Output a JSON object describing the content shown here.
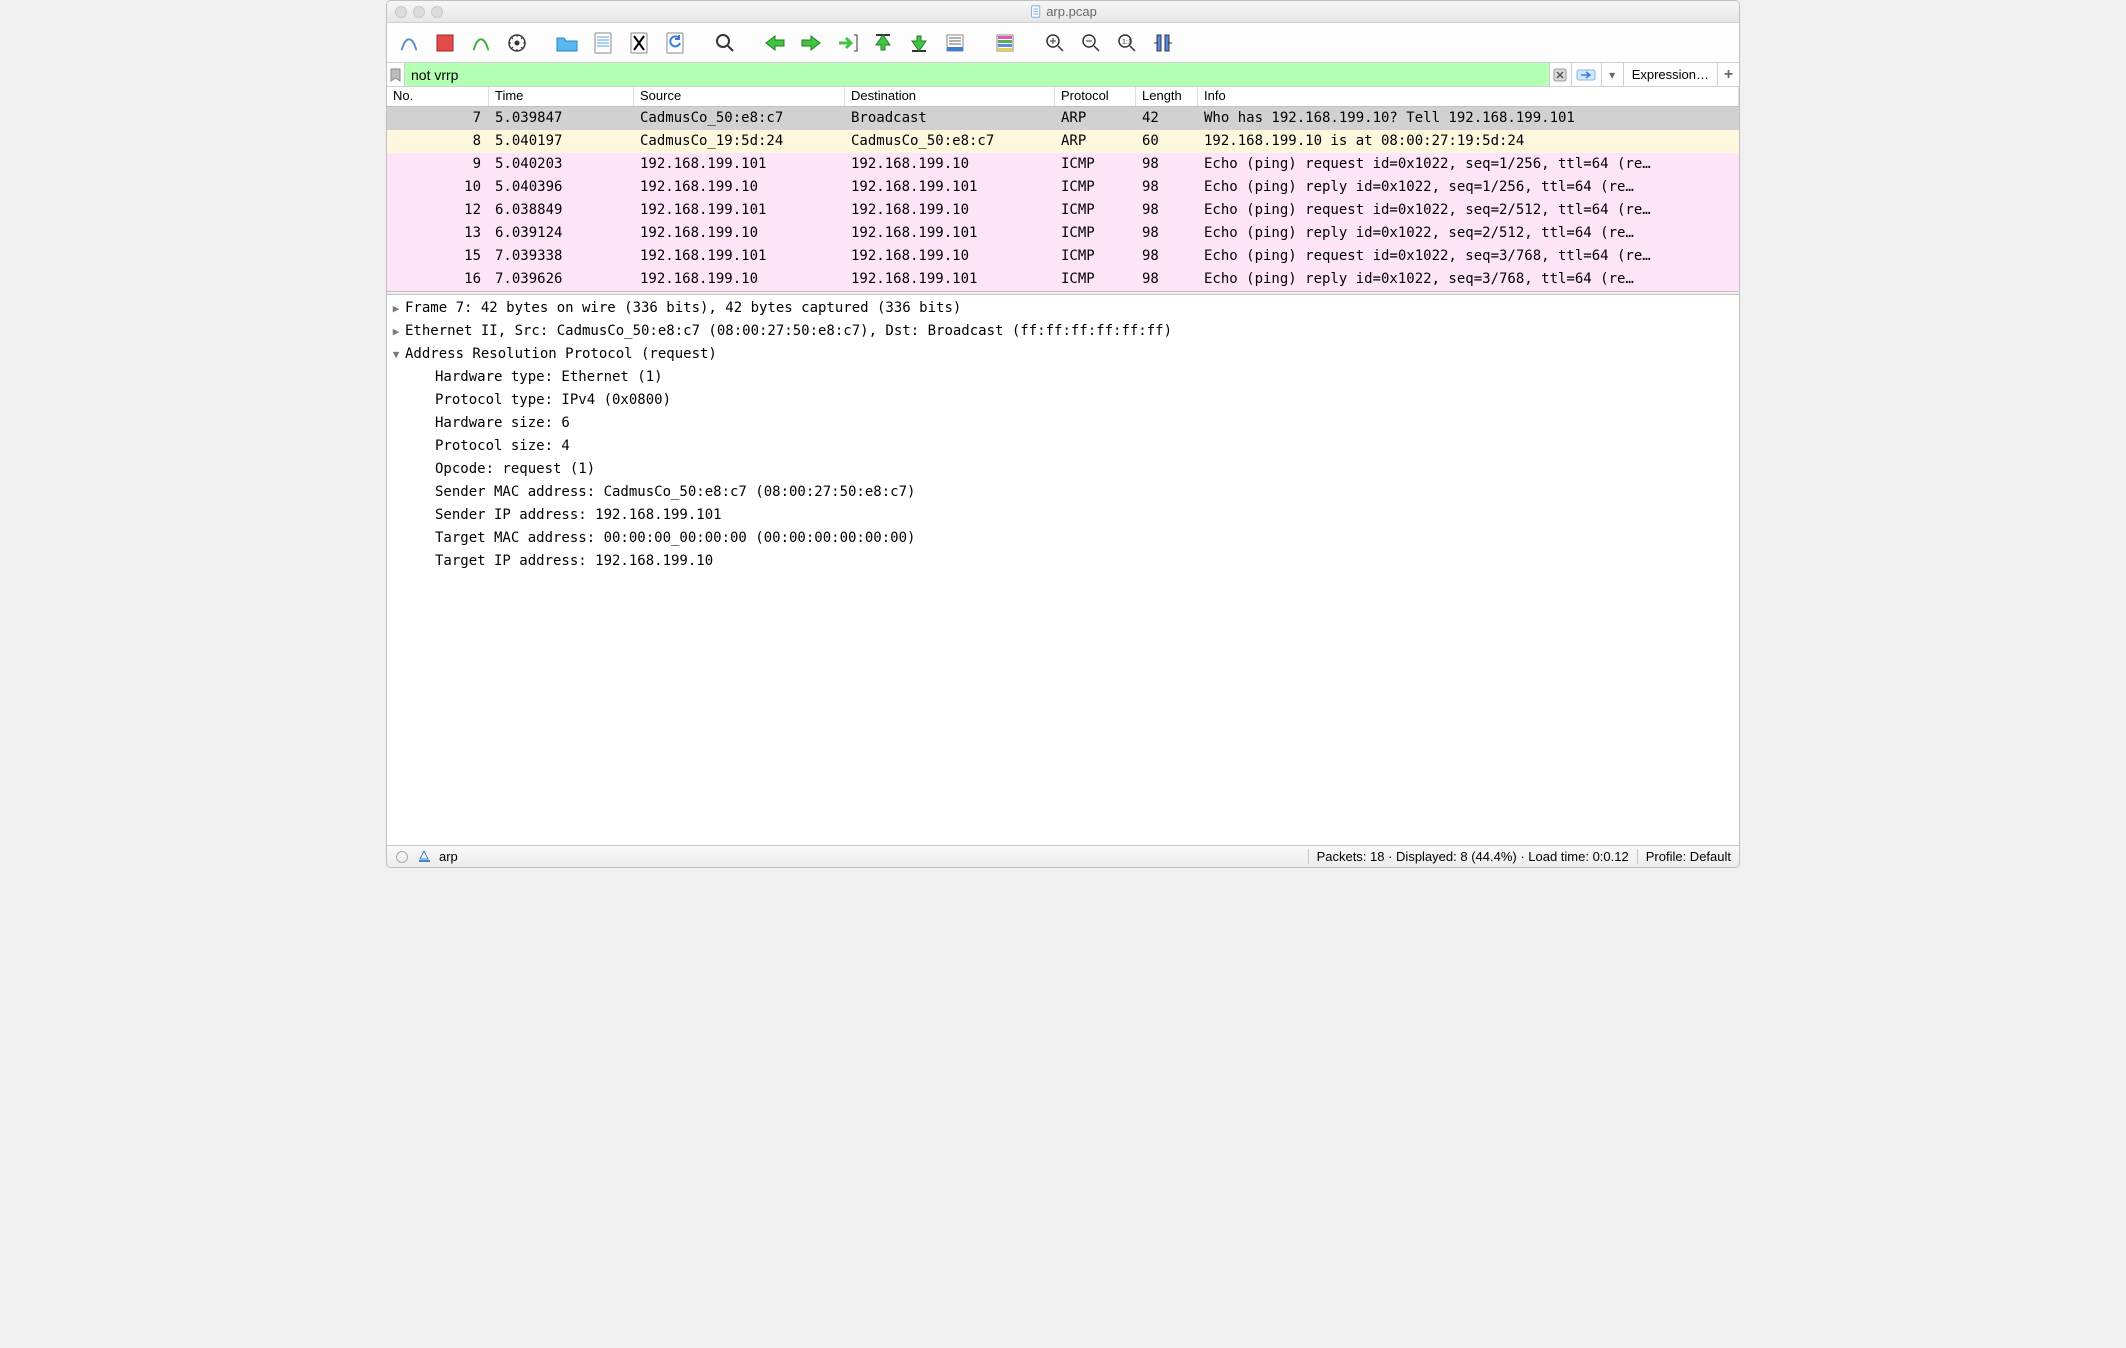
{
  "title": "arp.pcap",
  "filter": {
    "value": "not vrrp",
    "expression_label": "Expression…"
  },
  "columns": {
    "no": "No.",
    "time": "Time",
    "src": "Source",
    "dst": "Destination",
    "proto": "Protocol",
    "len": "Length",
    "info": "Info"
  },
  "packets": [
    {
      "no": "7",
      "time": "5.039847",
      "src": "CadmusCo_50:e8:c7",
      "dst": "Broadcast",
      "proto": "ARP",
      "len": "42",
      "info": "Who has 192.168.199.10? Tell 192.168.199.101",
      "cls": "sel"
    },
    {
      "no": "8",
      "time": "5.040197",
      "src": "CadmusCo_19:5d:24",
      "dst": "CadmusCo_50:e8:c7",
      "proto": "ARP",
      "len": "60",
      "info": "192.168.199.10 is at 08:00:27:19:5d:24",
      "cls": "yel"
    },
    {
      "no": "9",
      "time": "5.040203",
      "src": "192.168.199.101",
      "dst": "192.168.199.10",
      "proto": "ICMP",
      "len": "98",
      "info": "Echo (ping) request  id=0x1022, seq=1/256, ttl=64 (re…",
      "cls": "pink"
    },
    {
      "no": "10",
      "time": "5.040396",
      "src": "192.168.199.10",
      "dst": "192.168.199.101",
      "proto": "ICMP",
      "len": "98",
      "info": "Echo (ping) reply    id=0x1022, seq=1/256, ttl=64 (re…",
      "cls": "pink"
    },
    {
      "no": "12",
      "time": "6.038849",
      "src": "192.168.199.101",
      "dst": "192.168.199.10",
      "proto": "ICMP",
      "len": "98",
      "info": "Echo (ping) request  id=0x1022, seq=2/512, ttl=64 (re…",
      "cls": "pink"
    },
    {
      "no": "13",
      "time": "6.039124",
      "src": "192.168.199.10",
      "dst": "192.168.199.101",
      "proto": "ICMP",
      "len": "98",
      "info": "Echo (ping) reply    id=0x1022, seq=2/512, ttl=64 (re…",
      "cls": "pink"
    },
    {
      "no": "15",
      "time": "7.039338",
      "src": "192.168.199.101",
      "dst": "192.168.199.10",
      "proto": "ICMP",
      "len": "98",
      "info": "Echo (ping) request  id=0x1022, seq=3/768, ttl=64 (re…",
      "cls": "pink"
    },
    {
      "no": "16",
      "time": "7.039626",
      "src": "192.168.199.10",
      "dst": "192.168.199.101",
      "proto": "ICMP",
      "len": "98",
      "info": "Echo (ping) reply    id=0x1022, seq=3/768, ttl=64 (re…",
      "cls": "pink"
    }
  ],
  "details": {
    "frame": "Frame 7: 42 bytes on wire (336 bits), 42 bytes captured (336 bits)",
    "eth": "Ethernet II, Src: CadmusCo_50:e8:c7 (08:00:27:50:e8:c7), Dst: Broadcast (ff:ff:ff:ff:ff:ff)",
    "arp_hdr": "Address Resolution Protocol (request)",
    "arp": [
      "Hardware type: Ethernet (1)",
      "Protocol type: IPv4 (0x0800)",
      "Hardware size: 6",
      "Protocol size: 4",
      "Opcode: request (1)",
      "Sender MAC address: CadmusCo_50:e8:c7 (08:00:27:50:e8:c7)",
      "Sender IP address: 192.168.199.101",
      "Target MAC address: 00:00:00_00:00:00 (00:00:00:00:00:00)",
      "Target IP address: 192.168.199.10"
    ]
  },
  "status": {
    "proto": "arp",
    "summary": "Packets: 18 · Displayed: 8 (44.4%) · Load time: 0:0.12",
    "profile": "Profile: Default"
  }
}
